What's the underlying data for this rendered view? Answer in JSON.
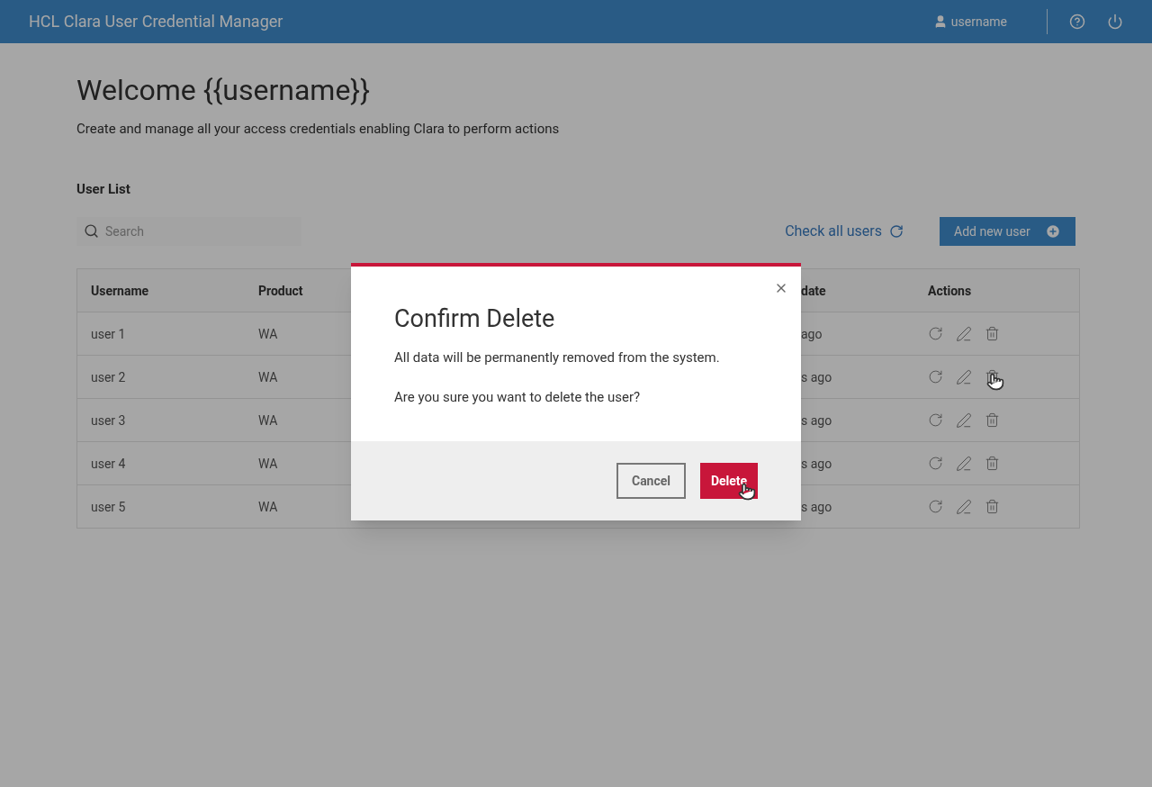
{
  "header": {
    "title": "HCL Clara User Credential Manager",
    "user": "username"
  },
  "page": {
    "title": "Welcome {{username}}",
    "subtitle": "Create and manage all your access credentials enabling Clara to perform actions",
    "section": "User List"
  },
  "search": {
    "placeholder": "Search"
  },
  "check_all": "Check all users",
  "add_button": "Add new user",
  "table": {
    "columns": [
      "Username",
      "Product",
      "date",
      "Actions"
    ],
    "rows": [
      {
        "username": "user 1",
        "product": "WA",
        "column_3": "ago"
      },
      {
        "username": "user 2",
        "product": "WA",
        "column_3": "s ago"
      },
      {
        "username": "user 3",
        "product": "WA",
        "column_3": "s ago"
      },
      {
        "username": "user 4",
        "product": "WA",
        "column_3": "s ago"
      },
      {
        "username": "user 5",
        "product": "WA",
        "column_3": "s ago"
      }
    ]
  },
  "dialog": {
    "title": "Confirm Delete",
    "message": "All data will be permanently removed from the system.",
    "question": "Are you sure you want to delete the user?",
    "buttons": [
      {
        "label": "Cancel",
        "kind": "secondary"
      },
      {
        "label": "Delete",
        "kind": "danger"
      }
    ]
  }
}
